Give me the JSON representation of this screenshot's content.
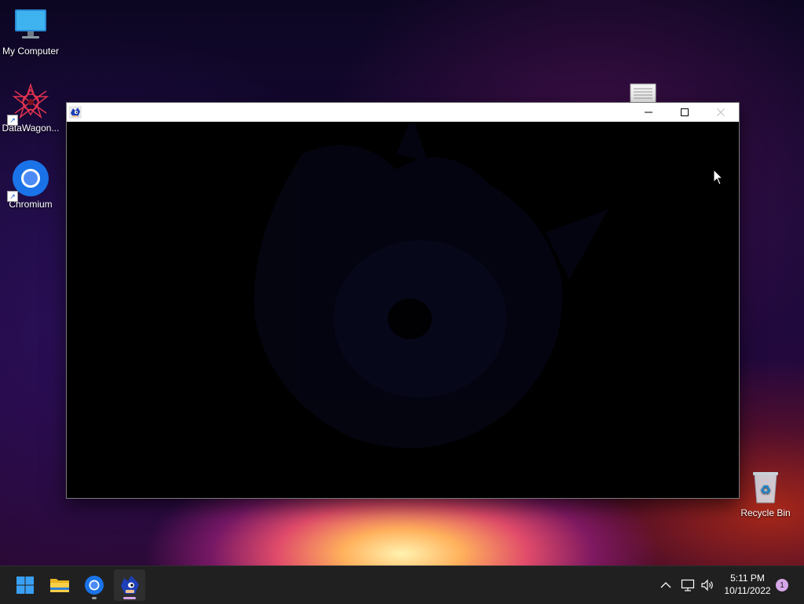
{
  "desktop": {
    "icons": [
      {
        "label": "My Computer",
        "icon": "monitor-icon"
      },
      {
        "label": "DataWagon...",
        "icon": "datawagon-icon",
        "shortcut": true
      },
      {
        "label": "Chromium",
        "icon": "chromium-icon",
        "shortcut": true
      },
      {
        "label": "Recycle Bin",
        "icon": "recycle-bin-icon"
      }
    ],
    "unlabeled_file": {
      "icon": "text-file-icon"
    }
  },
  "window": {
    "title": "",
    "icon": "sonic-app-icon",
    "controls": {
      "minimize": "minimize-icon",
      "maximize": "maximize-icon",
      "close": "close-icon"
    }
  },
  "taskbar": {
    "apps": [
      {
        "name": "Start",
        "icon": "windows-logo-icon"
      },
      {
        "name": "File Explorer",
        "icon": "folder-icon"
      },
      {
        "name": "Chromium",
        "icon": "chromium-icon",
        "running": true
      },
      {
        "name": "Sonic game",
        "icon": "sonic-app-icon",
        "running": true,
        "active": true
      }
    ],
    "tray": {
      "icons": [
        "chevron-up-icon",
        "network-icon",
        "volume-icon"
      ],
      "time": "5:11 PM",
      "date": "10/11/2022",
      "notification_count": "1"
    }
  },
  "colors": {
    "taskbar_bg": "#202020",
    "window_titlebar": "#ffffff",
    "window_client": "#000000",
    "accent_blue": "#0078d4",
    "active_indicator": "#d7a6e8"
  }
}
